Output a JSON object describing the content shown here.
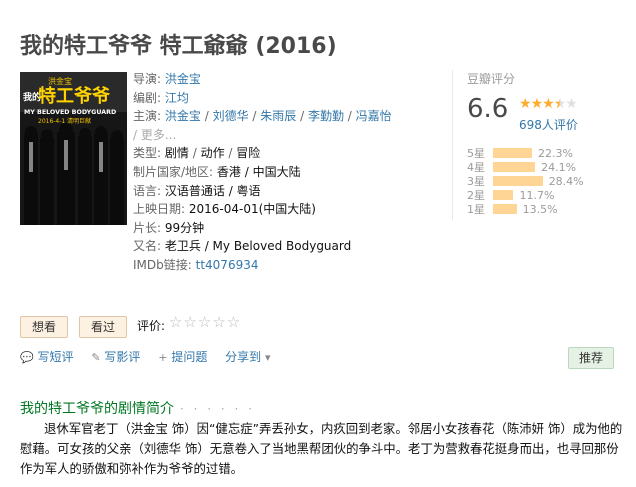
{
  "title": "我的特工爷爷 特工爺爺 (2016)",
  "poster": {
    "top_text": "洪金宝",
    "small_text": "我的",
    "big_text": "特工爷爷",
    "english": "MY BELOVED BODYGUARD",
    "date_text": "2016-4-1 清明巨献"
  },
  "info": {
    "director_label": "导演:",
    "director": "洪金宝",
    "writer_label": "编剧:",
    "writer": "江均",
    "cast_label": "主演:",
    "cast": [
      "洪金宝",
      "刘德华",
      "朱雨辰",
      "李勤勤",
      "冯嘉怡"
    ],
    "more": "更多...",
    "genre_label": "类型:",
    "genres": [
      "剧情",
      "动作",
      "冒险"
    ],
    "region_label": "制片国家/地区:",
    "region": "香港 / 中国大陆",
    "language_label": "语言:",
    "language": "汉语普通话 / 粤语",
    "release_label": "上映日期:",
    "release": "2016-04-01(中国大陆)",
    "runtime_label": "片长:",
    "runtime": "99分钟",
    "aka_label": "又名:",
    "aka": "老卫兵 / My Beloved Bodyguard",
    "imdb_label": "IMDb链接:",
    "imdb": "tt4076934"
  },
  "rating": {
    "header": "豆瓣评分",
    "score": "6.6",
    "stars_filled": 3.5,
    "count": "698人评价",
    "bars": [
      {
        "label": "5星",
        "pct": "22.3%",
        "value": 22.3
      },
      {
        "label": "4星",
        "pct": "24.1%",
        "value": 24.1
      },
      {
        "label": "3星",
        "pct": "28.4%",
        "value": 28.4
      },
      {
        "label": "2星",
        "pct": "11.7%",
        "value": 11.7
      },
      {
        "label": "1星",
        "pct": "13.5%",
        "value": 13.5
      }
    ]
  },
  "buttons": {
    "want": "想看",
    "seen": "看过",
    "rate_label": "评价:",
    "rate_stars": "☆☆☆☆☆"
  },
  "actions": {
    "short_review": "写短评",
    "review": "写影评",
    "question": "提问题",
    "share": "分享到",
    "recommend": "推荐"
  },
  "synopsis": {
    "title": "我的特工爷爷的剧情简介",
    "dots": "· · · · · ·",
    "body": "退休军官老丁（洪金宝 饰）因“健忘症”弄丢孙女，内疚回到老家。邻居小女孩春花（陈沛妍 饰）成为他的慰藉。可女孩的父亲（刘德华 饰）无意卷入了当地黑帮团伙的争斗中。老丁为营救春花挺身而出，也寻回那份作为军人的骄傲和弥补作为爷爷的过错。"
  }
}
